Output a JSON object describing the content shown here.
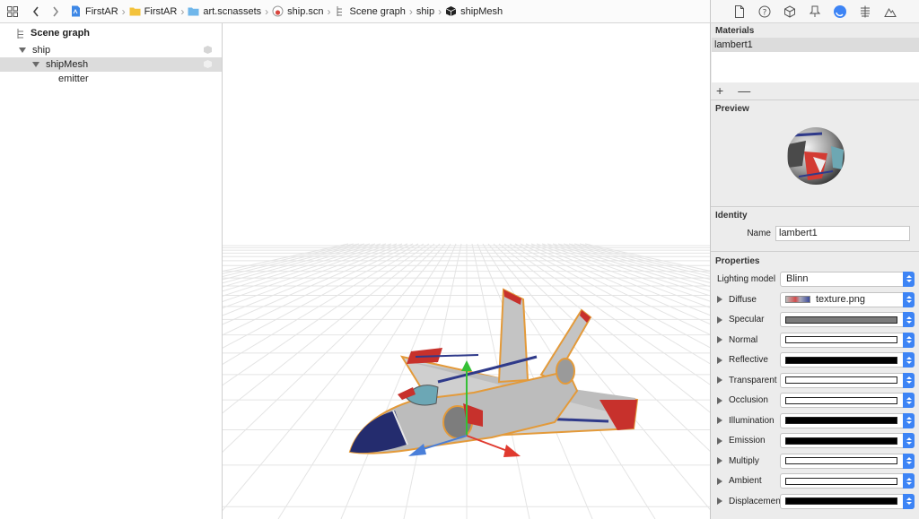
{
  "breadcrumbs": [
    {
      "label": "FirstAR",
      "icon": "project-file-icon"
    },
    {
      "label": "FirstAR",
      "icon": "folder-icon"
    },
    {
      "label": "art.scnassets",
      "icon": "folder-icon"
    },
    {
      "label": "ship.scn",
      "icon": "scene-file-icon"
    },
    {
      "label": "Scene graph",
      "icon": "scene-graph-icon"
    },
    {
      "label": "ship",
      "icon": ""
    },
    {
      "label": "shipMesh",
      "icon": "cube-icon"
    }
  ],
  "outline": {
    "header": "Scene graph",
    "nodes": [
      {
        "label": "ship"
      },
      {
        "label": "shipMesh"
      },
      {
        "label": "emitter"
      }
    ]
  },
  "inspector": {
    "materials": {
      "title": "Materials",
      "items": [
        "lambert1"
      ],
      "add": "+",
      "remove": "—"
    },
    "preview": {
      "title": "Preview"
    },
    "identity": {
      "title": "Identity",
      "name_label": "Name",
      "name_value": "lambert1"
    },
    "properties": {
      "title": "Properties",
      "lighting_label": "Lighting model",
      "lighting_value": "Blinn",
      "rows": [
        {
          "label": "Diffuse",
          "kind": "texture",
          "value": "texture.png"
        },
        {
          "label": "Specular",
          "color": "#7b7b7b"
        },
        {
          "label": "Normal",
          "color": "#ffffff"
        },
        {
          "label": "Reflective",
          "color": "#000000"
        },
        {
          "label": "Transparent",
          "color": "#ffffff"
        },
        {
          "label": "Occlusion",
          "color": "#ffffff"
        },
        {
          "label": "Illumination",
          "color": "#000000"
        },
        {
          "label": "Emission",
          "color": "#000000"
        },
        {
          "label": "Multiply",
          "color": "#ffffff"
        },
        {
          "label": "Ambient",
          "color": "#ffffff"
        },
        {
          "label": "Displacemen",
          "color": "#000000"
        }
      ]
    }
  },
  "colors": {
    "accent": "#3d84f5",
    "selection": "#dcdcdc"
  }
}
